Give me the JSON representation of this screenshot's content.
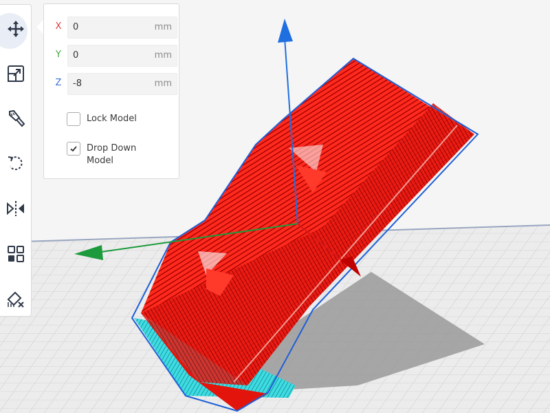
{
  "toolbar": {
    "tools": [
      {
        "icon": "move-icon",
        "active": true
      },
      {
        "icon": "scale-icon",
        "active": false
      },
      {
        "icon": "rotate-icon",
        "active": false
      },
      {
        "icon": "paint-brush-icon",
        "active": false
      },
      {
        "icon": "mirror-icon",
        "active": false
      },
      {
        "icon": "per-model-settings-icon",
        "active": false
      },
      {
        "icon": "support-blocker-icon",
        "active": false
      }
    ]
  },
  "move_panel": {
    "x": {
      "label": "X",
      "value": "0",
      "unit": "mm",
      "color": "#e33b3b"
    },
    "y": {
      "label": "Y",
      "value": "0",
      "unit": "mm",
      "color": "#3ca53c"
    },
    "z": {
      "label": "Z",
      "value": "-8",
      "unit": "mm",
      "color": "#3a6fd6"
    },
    "lock_model": {
      "label": "Lock Model",
      "checked": false
    },
    "drop_down_model": {
      "label": "Drop Down\nModel",
      "checked": true
    }
  },
  "colors": {
    "model": "#ff1a1a",
    "model_shadow": "#b00000",
    "outline": "#1f5fd6",
    "axis_x": "#e02020",
    "axis_y": "#1c9a3c",
    "axis_z": "#1f6fe0",
    "build_plate": "#e8e8e8",
    "support": "#33d6e0"
  }
}
